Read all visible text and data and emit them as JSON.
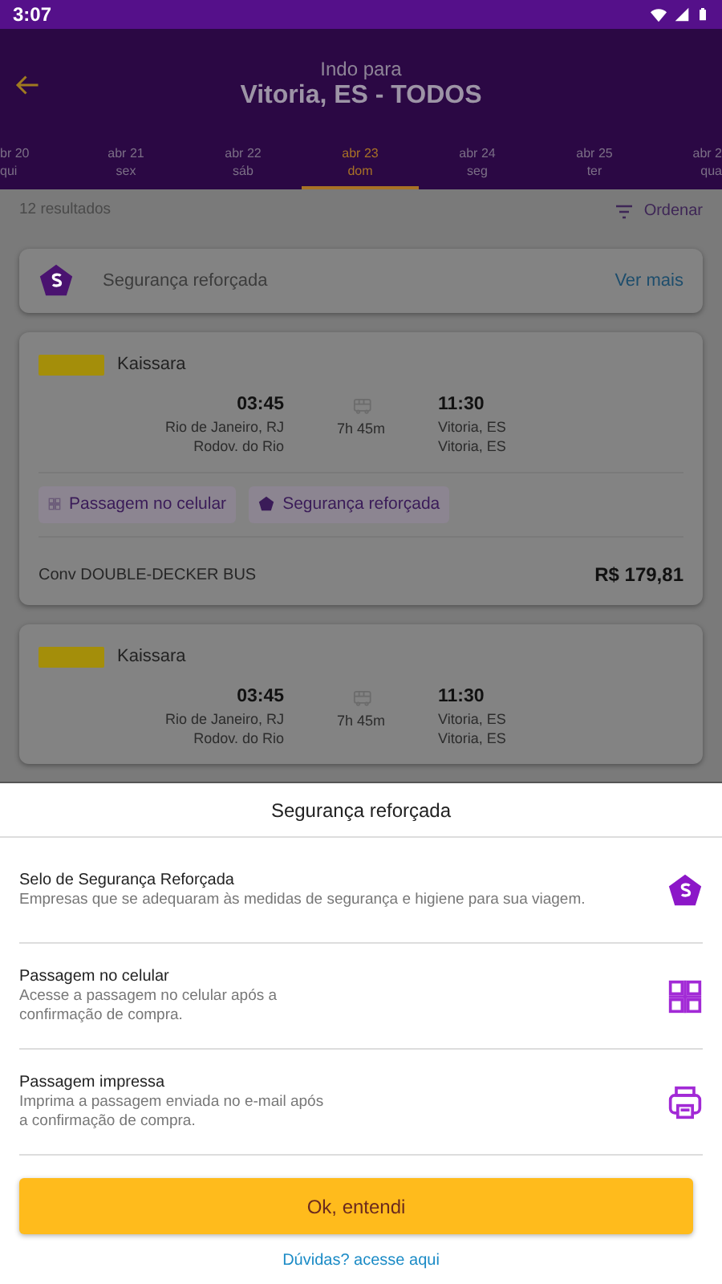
{
  "status_bar": {
    "time": "3:07"
  },
  "header": {
    "subtitle": "Indo para",
    "title": "Vitoria, ES - TODOS"
  },
  "dates": [
    {
      "date": "br 20",
      "weekday": "qui",
      "selected": false
    },
    {
      "date": "abr 21",
      "weekday": "sex",
      "selected": false
    },
    {
      "date": "abr 22",
      "weekday": "sáb",
      "selected": false
    },
    {
      "date": "abr 23",
      "weekday": "dom",
      "selected": true
    },
    {
      "date": "abr 24",
      "weekday": "seg",
      "selected": false
    },
    {
      "date": "abr 25",
      "weekday": "ter",
      "selected": false
    },
    {
      "date": "abr 2",
      "weekday": "qua",
      "selected": false
    }
  ],
  "results": {
    "count": "12 resultados",
    "sort": "Ordenar"
  },
  "banner": {
    "label": "Segurança reforçada",
    "link": "Ver mais"
  },
  "trips": [
    {
      "operator": "Kaissara",
      "departure_time": "03:45",
      "departure_city": "Rio de Janeiro, RJ",
      "departure_station": "Rodov. do Rio",
      "duration": "7h 45m",
      "arrival_time": "11:30",
      "arrival_city": "Vitoria, ES",
      "arrival_station": "Vitoria, ES",
      "features": [
        {
          "label": "Passagem no celular",
          "kind": "qr"
        },
        {
          "label": "Segurança reforçada",
          "kind": "seal"
        }
      ],
      "bus_type": "Conv DOUBLE-DECKER  BUS",
      "price": "R$ 179,81"
    },
    {
      "operator": "Kaissara",
      "departure_time": "03:45",
      "departure_city": "Rio de Janeiro, RJ",
      "departure_station": "Rodov. do Rio",
      "duration": "7h 45m",
      "arrival_time": "11:30",
      "arrival_city": "Vitoria, ES",
      "arrival_station": "Vitoria, ES"
    }
  ],
  "sheet": {
    "title": "Segurança reforçada",
    "items": [
      {
        "title": "Selo de Segurança Reforçada",
        "description": "Empresas que se adequaram às medidas de segurança e higiene para sua viagem.",
        "kind": "seal"
      },
      {
        "title": "Passagem no celular",
        "description": "Acesse a passagem no celular após a confirmação de compra.",
        "kind": "qr"
      },
      {
        "title": "Passagem impressa",
        "description": "Imprima a passagem enviada no e-mail após a confirmação de compra.",
        "kind": "printer"
      }
    ],
    "button": "Ok, entendi",
    "link": "Dúvidas? acesse aqui"
  }
}
